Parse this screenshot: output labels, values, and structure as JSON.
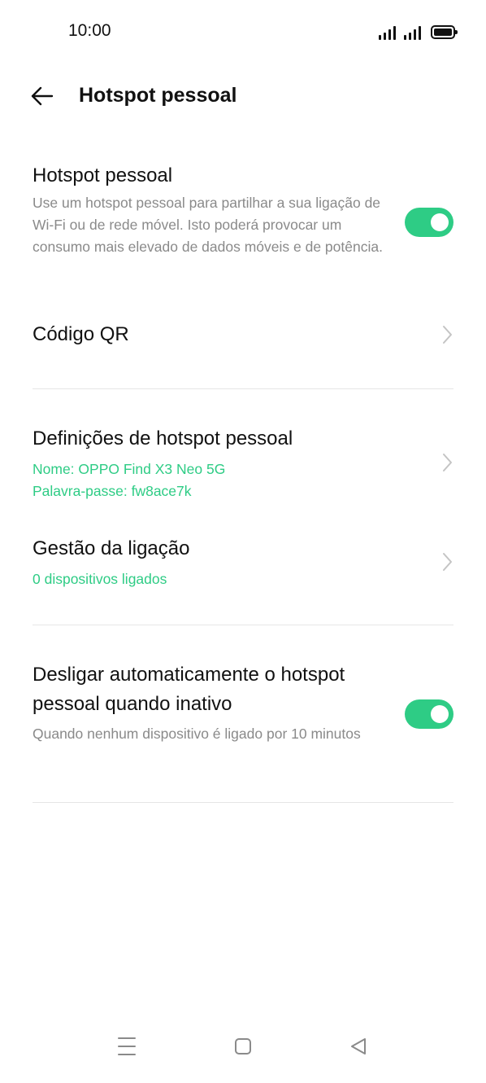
{
  "status_bar": {
    "time": "10:00"
  },
  "header": {
    "title": "Hotspot pessoal"
  },
  "hotspot": {
    "title": "Hotspot pessoal",
    "description": "Use um hotspot pessoal para partilhar a sua ligação de Wi-Fi ou de rede móvel. Isto poderá provocar um consumo mais elevado de dados móveis e de potência.",
    "enabled": true
  },
  "qr_code": {
    "title": "Código QR"
  },
  "settings": {
    "title": "Definições de hotspot pessoal",
    "name_line": "Nome: OPPO Find X3 Neo 5G",
    "password_line": "Palavra-passe: fw8ace7k"
  },
  "connection": {
    "title": "Gestão da ligação",
    "devices_line": "0 dispositivos ligados"
  },
  "auto_off": {
    "title": "Desligar automaticamente o hotspot pessoal quando inativo",
    "description": "Quando nenhum dispositivo é ligado por 10 minutos",
    "enabled": true
  },
  "colors": {
    "accent": "#2ecc85",
    "divider": "#e6e6e6",
    "secondary_text": "#8a8a8a"
  },
  "icons": {
    "back": "arrow-left-icon",
    "chevron": "chevron-right-icon",
    "nav_menu": "menu-icon",
    "nav_home": "square-icon",
    "nav_back": "triangle-back-icon"
  }
}
